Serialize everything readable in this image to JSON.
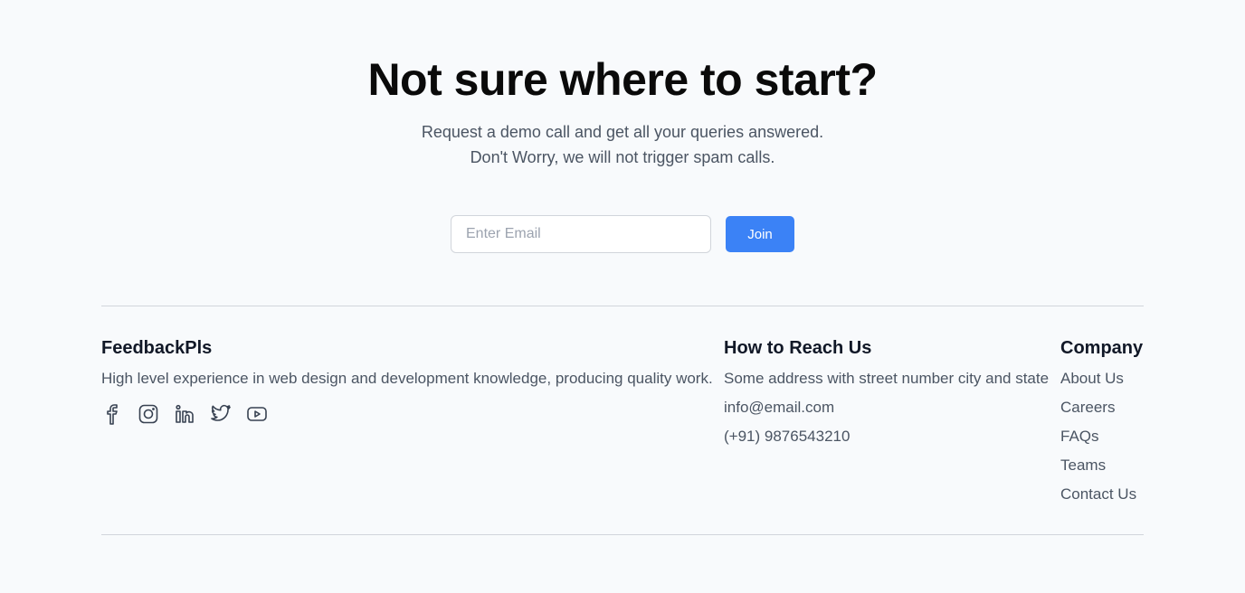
{
  "cta": {
    "title": "Not sure where to start?",
    "subtitle_line1": "Request a demo call and get all your queries answered.",
    "subtitle_line2": "Don't Worry, we will not trigger spam calls.",
    "email_placeholder": "Enter Email",
    "email_value": "",
    "join_label": "Join",
    "accent_color": "#3b82f6"
  },
  "footer": {
    "brand": {
      "name": "FeedbackPls",
      "tagline": "High level experience in web design and development knowledge, producing quality work.",
      "social_icons": [
        "facebook-icon",
        "instagram-icon",
        "linkedin-icon",
        "twitter-icon",
        "youtube-icon"
      ]
    },
    "reach": {
      "heading": "How to Reach Us",
      "address": "Some address with street number city and state",
      "email": "info@email.com",
      "phone": "(+91) 9876543210"
    },
    "company": {
      "heading": "Company",
      "links": [
        "About Us",
        "Careers",
        "FAQs",
        "Teams",
        "Contact Us"
      ]
    }
  }
}
